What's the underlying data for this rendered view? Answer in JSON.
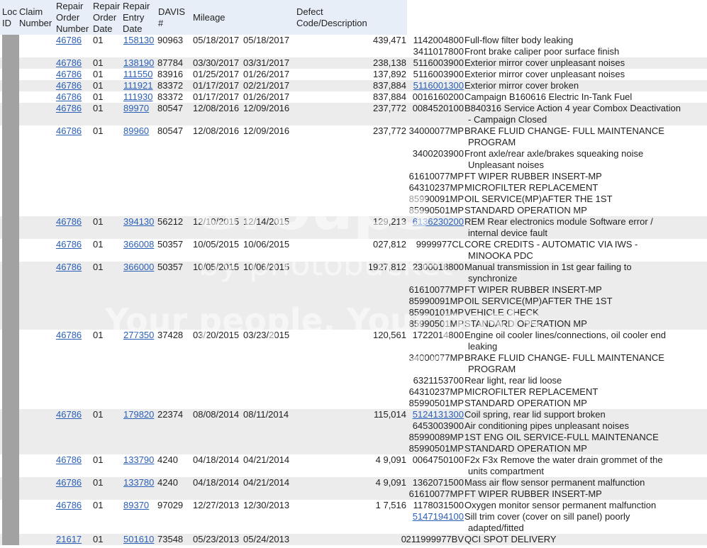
{
  "headers": {
    "loc_id": [
      "Loc",
      "ID"
    ],
    "claim_number": [
      "Claim",
      "Number"
    ],
    "repair_order_number": [
      "Repair",
      "Order",
      "Number"
    ],
    "repair_order_date": [
      "Repair",
      "Order",
      "Date"
    ],
    "repair_entry_date": [
      "Repair",
      "Entry",
      "Date"
    ],
    "davis": [
      "DAVIS",
      "#"
    ],
    "mileage": [
      "Mileage"
    ],
    "defect": [
      "Defect",
      "Code/Description"
    ]
  },
  "rows": [
    {
      "claim": "46786",
      "order": "01",
      "repair": "158130",
      "davis": "90963",
      "ro_date": "05/18/2017",
      "entry_date": "05/18/2017",
      "mileage": "439,471",
      "defects": [
        {
          "code": "1142004800",
          "desc": [
            "Full-flow filter body leaking"
          ]
        },
        {
          "code": "3411017800",
          "desc": [
            "Front brake caliper poor surface finish"
          ]
        }
      ]
    },
    {
      "claim": "46786",
      "order": "01",
      "repair": "138190",
      "davis": "87784",
      "ro_date": "03/30/2017",
      "entry_date": "03/31/2017",
      "mileage": "238,138",
      "defects": [
        {
          "code": "5116003900",
          "desc": [
            "Exterior mirror cover unpleasant noises"
          ]
        }
      ]
    },
    {
      "claim": "46786",
      "order": "01",
      "repair": "111550",
      "davis": "83916",
      "ro_date": "01/25/2017",
      "entry_date": "01/26/2017",
      "mileage": "137,892",
      "defects": [
        {
          "code": "5116003900",
          "desc": [
            "Exterior mirror cover unpleasant noises"
          ]
        }
      ]
    },
    {
      "claim": "46786",
      "order": "01",
      "repair": "111921",
      "davis": "83372",
      "ro_date": "01/17/2017",
      "entry_date": "02/21/2017",
      "mileage": "837,884",
      "defects": [
        {
          "code": "5116001300",
          "link": true,
          "desc": [
            "Exterior mirror cover broken"
          ]
        }
      ]
    },
    {
      "claim": "46786",
      "order": "01",
      "repair": "111930",
      "davis": "83372",
      "ro_date": "01/17/2017",
      "entry_date": "01/26/2017",
      "mileage": "837,884",
      "defects": [
        {
          "code": "0016160200",
          "desc": [
            "Campaign B160616 Electric In-Tank Fuel"
          ]
        }
      ]
    },
    {
      "claim": "46786",
      "order": "01",
      "repair": "89970",
      "davis": "80547",
      "ro_date": "12/08/2016",
      "entry_date": "12/09/2016",
      "mileage": "237,772",
      "defects": [
        {
          "code": "0084520100",
          "desc": [
            "B840316 Service Action 4 year Combox Deactivation",
            "- Campaign Closed"
          ]
        }
      ]
    },
    {
      "claim": "46786",
      "order": "01",
      "repair": "89960",
      "davis": "80547",
      "ro_date": "12/08/2016",
      "entry_date": "12/09/2016",
      "mileage": "237,772",
      "defects": [
        {
          "code": "34000077MP",
          "desc": [
            "BRAKE FLUID CHANGE- FULL MAINTENANCE",
            "PROGRAM"
          ]
        },
        {
          "code": "3400203900",
          "desc": [
            "Front axle/rear axle/brakes squeaking noise",
            "Unpleasant noises"
          ]
        },
        {
          "code": "61610077MP",
          "desc": [
            "FT WIPER RUBBER INSERT-MP"
          ]
        },
        {
          "code": "64310237MP",
          "desc": [
            "MICROFILTER REPLACEMENT"
          ]
        },
        {
          "code": "85990091MP",
          "desc": [
            "OIL SERVICE(MP)AFTER THE 1ST"
          ]
        },
        {
          "code": "85990501MP",
          "desc": [
            "STANDARD OPERATION MP"
          ]
        }
      ]
    },
    {
      "claim": "46786",
      "order": "01",
      "repair": "394130",
      "davis": "56212",
      "ro_date": "12/10/2015",
      "entry_date": "12/14/2015",
      "mileage": "129,213",
      "defects": [
        {
          "code": "6136230200",
          "link": true,
          "desc": [
            "REM Rear electronics module Software error /",
            "internal device fault"
          ]
        }
      ]
    },
    {
      "claim": "46786",
      "order": "01",
      "repair": "366008",
      "davis": "50357",
      "ro_date": "10/05/2015",
      "entry_date": "10/06/2015",
      "mileage": "027,812",
      "defects": [
        {
          "code": "9999977CL",
          "desc": [
            "CORE CREDITS - AUTOMATIC VIA IWS -",
            "MINOOKA PDC"
          ]
        }
      ]
    },
    {
      "claim": "46786",
      "order": "01",
      "repair": "366000",
      "davis": "50357",
      "ro_date": "10/05/2015",
      "entry_date": "10/06/2015",
      "mileage": "1927,812",
      "defects": [
        {
          "code": "2300018800",
          "desc": [
            "Manual transmission in 1st gear failing to",
            "synchronize"
          ]
        },
        {
          "code": "61610077MP",
          "desc": [
            "FT WIPER RUBBER INSERT-MP"
          ]
        },
        {
          "code": "85990091MP",
          "desc": [
            "OIL SERVICE(MP)AFTER THE 1ST"
          ]
        },
        {
          "code": "85990101MP",
          "desc": [
            "VEHICLE CHECK"
          ]
        },
        {
          "code": "85990501MP",
          "desc": [
            "STANDARD OPERATION MP"
          ]
        }
      ]
    },
    {
      "claim": "46786",
      "order": "01",
      "repair": "277350",
      "davis": "37428",
      "ro_date": "03/20/2015",
      "entry_date": "03/23/2015",
      "mileage": "120,561",
      "defects": [
        {
          "code": "1722014800",
          "desc": [
            "Engine oil cooler lines/connections, oil cooler end",
            "leaking"
          ]
        },
        {
          "code": "34000077MP",
          "desc": [
            "BRAKE FLUID CHANGE- FULL MAINTENANCE",
            "PROGRAM"
          ]
        },
        {
          "code": "6321153700",
          "desc": [
            "Rear light, rear lid loose"
          ]
        },
        {
          "code": "64310237MP",
          "desc": [
            "MICROFILTER REPLACEMENT"
          ]
        },
        {
          "code": "85990501MP",
          "desc": [
            "STANDARD OPERATION MP"
          ]
        }
      ]
    },
    {
      "claim": "46786",
      "order": "01",
      "repair": "179820",
      "davis": "22374",
      "ro_date": "08/08/2014",
      "entry_date": "08/11/2014",
      "mileage": "115,014",
      "defects": [
        {
          "code": "5124131300",
          "link": true,
          "desc": [
            "Coil spring, rear lid support broken"
          ]
        },
        {
          "code": "6453003900",
          "desc": [
            "Air conditioning pipes unpleasant noises"
          ]
        },
        {
          "code": "85990089MP",
          "desc": [
            "1ST ENG OIL SERVICE-FULL MAINTENANCE"
          ]
        },
        {
          "code": "85990501MP",
          "desc": [
            "STANDARD OPERATION MP"
          ]
        }
      ]
    },
    {
      "claim": "46786",
      "order": "01",
      "repair": "133790",
      "davis": "4240",
      "ro_date": "04/18/2014",
      "entry_date": "04/21/2014",
      "mileage": "4 9,091",
      "defects": [
        {
          "code": "0064750100",
          "desc": [
            "F2x F3x Remove the water drain grommet of the",
            "units compartment"
          ]
        }
      ]
    },
    {
      "claim": "46786",
      "order": "01",
      "repair": "133780",
      "davis": "4240",
      "ro_date": "04/18/2014",
      "entry_date": "04/21/2014",
      "mileage": "4 9,091",
      "defects": [
        {
          "code": "1362071500",
          "desc": [
            "Mass air flow sensor permanent malfunction"
          ]
        },
        {
          "code": "61610077MP",
          "desc": [
            "FT WIPER RUBBER INSERT-MP"
          ]
        }
      ]
    },
    {
      "claim": "46786",
      "order": "01",
      "repair": "89370",
      "davis": "97029",
      "ro_date": "12/27/2013",
      "entry_date": "12/30/2013",
      "mileage": "1 7,516",
      "defects": [
        {
          "code": "1178031500",
          "desc": [
            "Oxygen monitor sensor permanent malfunction"
          ]
        },
        {
          "code": "5147194100",
          "link": true,
          "desc": [
            "Sill trim cover (cover on sill panel) poorly",
            "adapted/fitted"
          ]
        }
      ]
    },
    {
      "claim": "21617",
      "order": "01",
      "repair": "501610",
      "davis": "73548",
      "ro_date": "05/23/2013",
      "entry_date": "05/24/2013",
      "mileage": "0",
      "defects": [
        {
          "code": "211999977BV",
          "desc": [
            "QCI SPOT DELIVERY"
          ]
        }
      ]
    }
  ],
  "watermark": {
    "brand": "Groups",
    "byline": "by photobucket",
    "tagline1": "Your people. Your posts.",
    "tagline2": "Your space."
  },
  "colors": {
    "link": "#2a5fb8",
    "header_bg": "#e8eef8",
    "row_shade": "#ececec",
    "loc_bar": "#a2a2a2"
  }
}
